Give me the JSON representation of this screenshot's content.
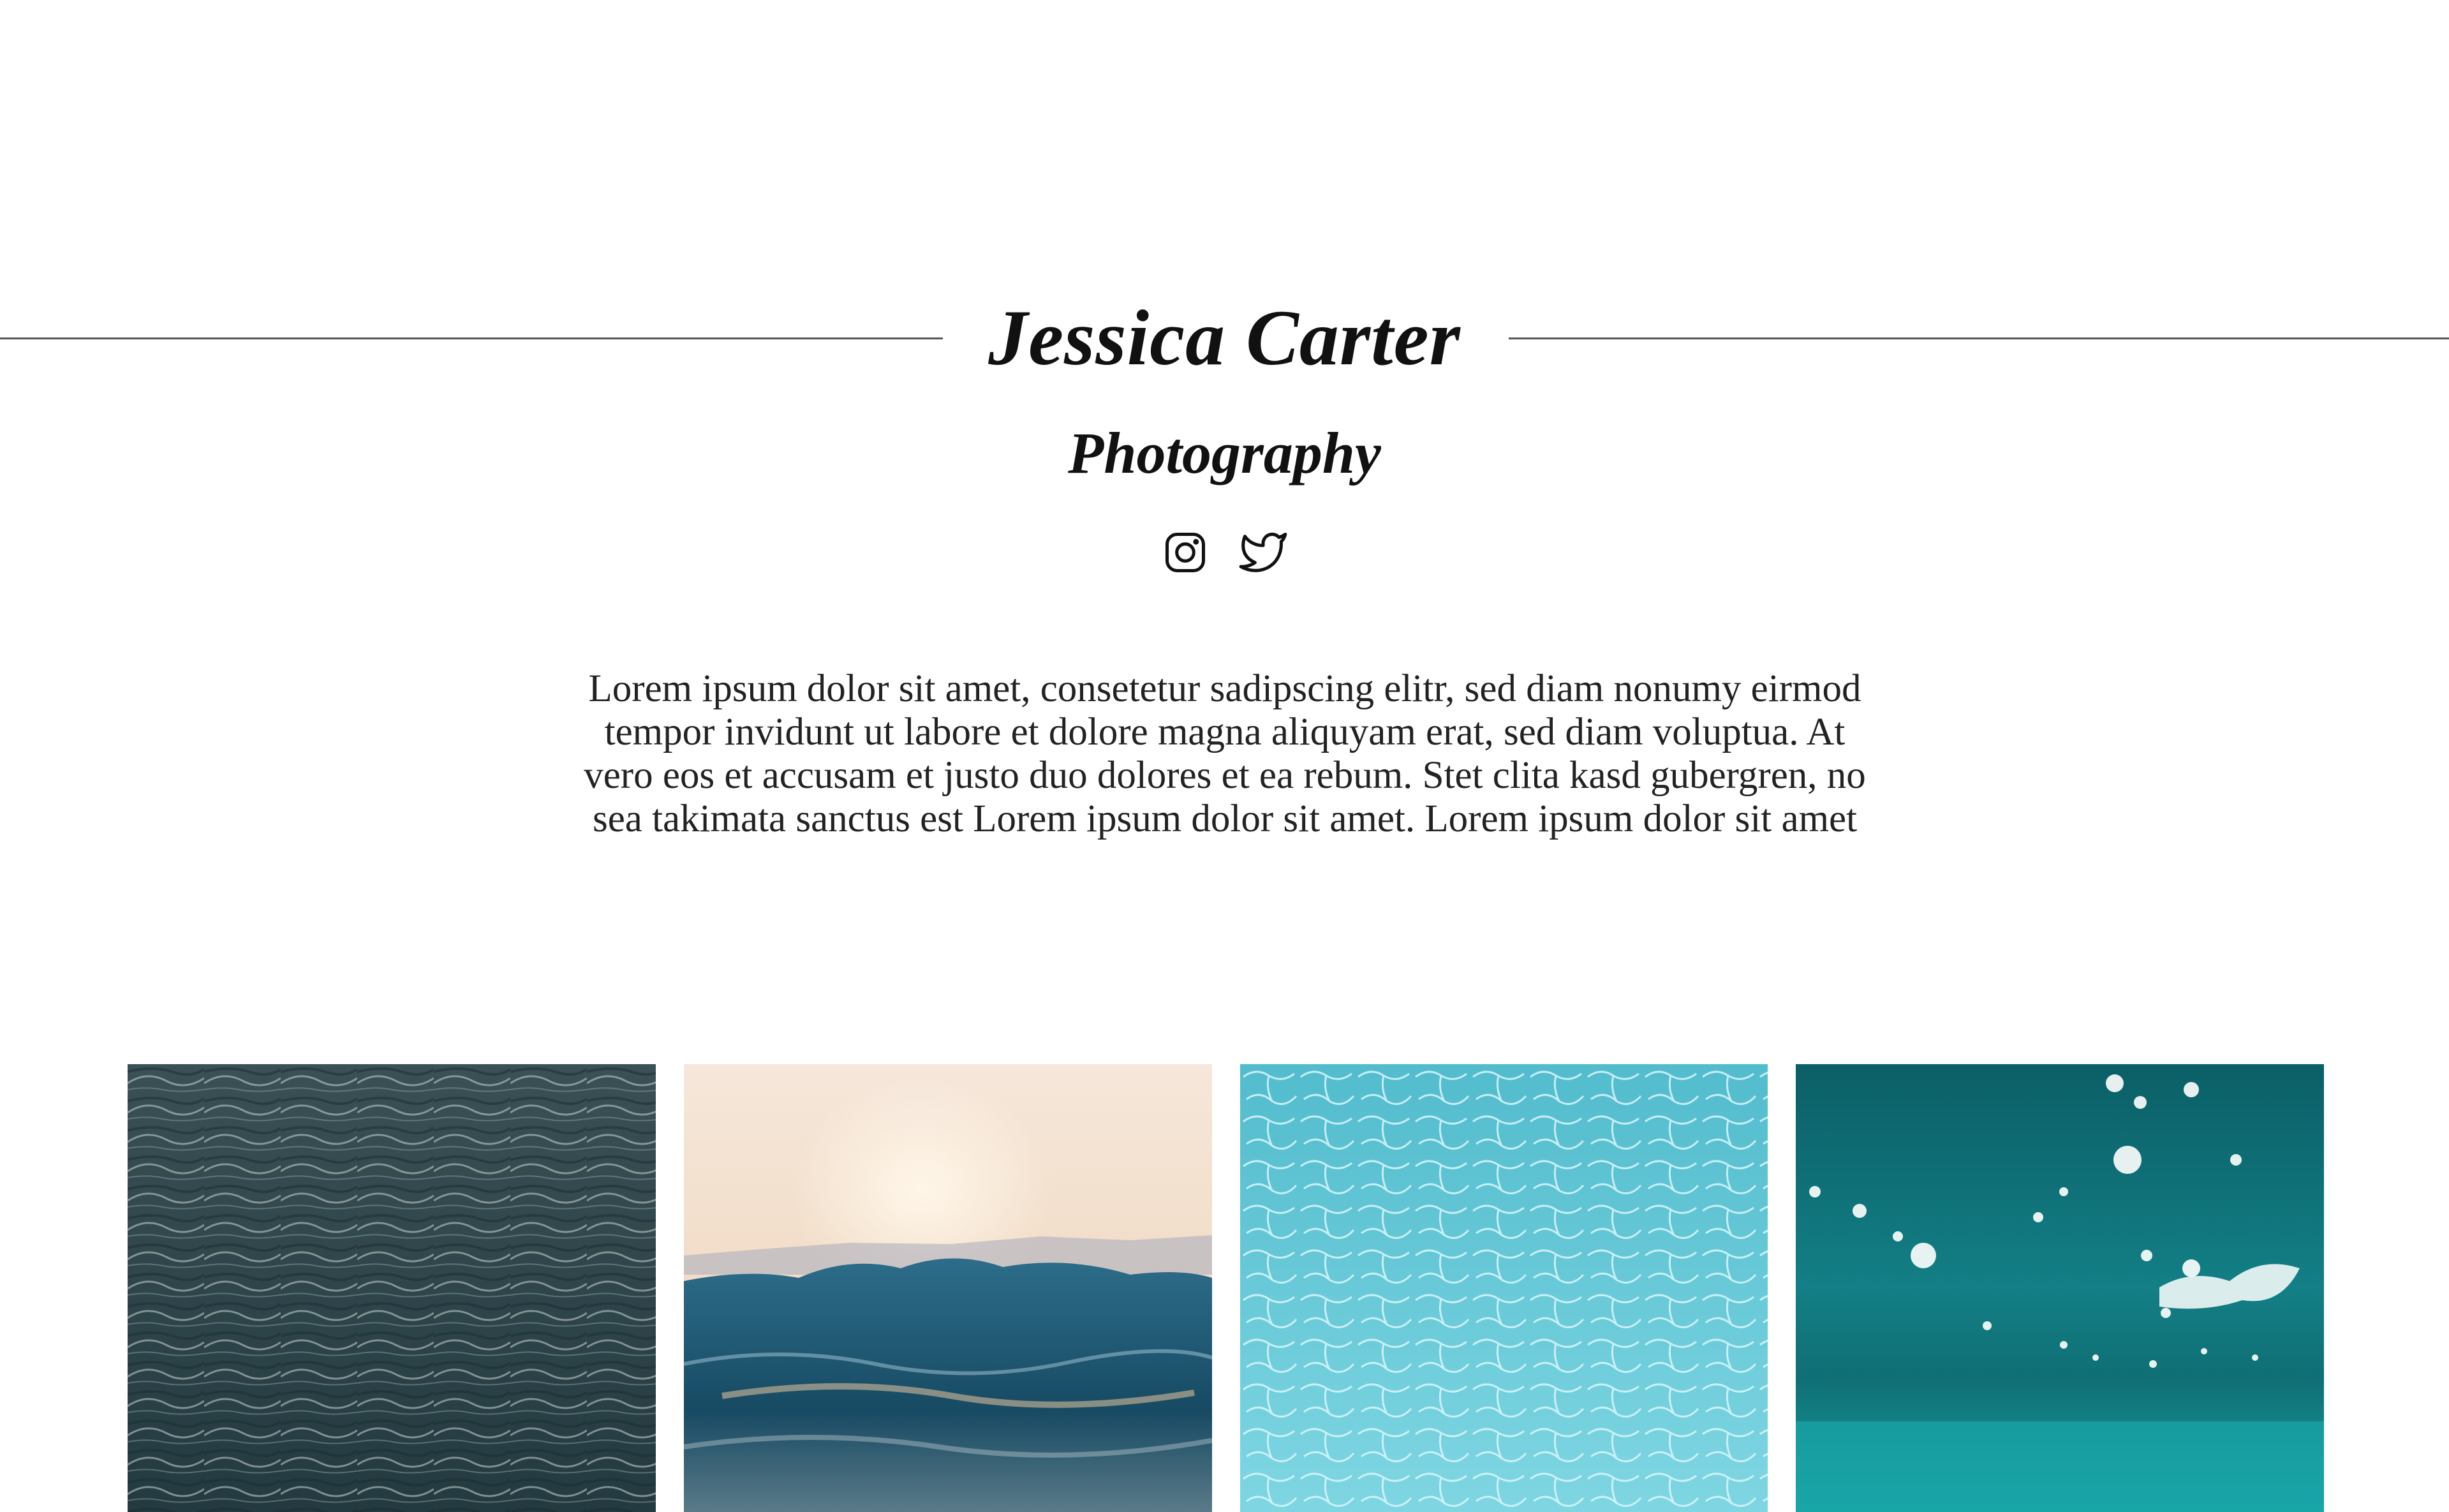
{
  "header": {
    "title": "Jessica Carter",
    "subtitle": "Photography"
  },
  "social": [
    {
      "name": "Instagram",
      "icon": "instagram-icon"
    },
    {
      "name": "Twitter",
      "icon": "twitter-icon"
    }
  ],
  "intro": {
    "text": "Lorem ipsum dolor sit amet, consetetur sadipscing elitr, sed diam nonumy eirmod tempor invidunt ut labore et dolore magna aliquyam erat, sed diam voluptua. At vero eos et accusam et justo duo dolores et ea rebum. Stet clita kasd gubergren, no sea takimata sanctus est Lorem ipsum dolor sit amet. Lorem ipsum dolor sit amet"
  },
  "gallery": [
    {
      "subject": "dark rippled water",
      "colors": [
        "#2b4248",
        "#4a6469",
        "#c9d3d2"
      ]
    },
    {
      "subject": "ocean wave at sunset",
      "colors": [
        "#f3e2d4",
        "#1f5670",
        "#e6b98a"
      ]
    },
    {
      "subject": "turquoise pool water",
      "colors": [
        "#6fc9d8",
        "#b8ecf2",
        "#3aa6bd"
      ]
    },
    {
      "subject": "underwater teal bubbles",
      "colors": [
        "#0d7178",
        "#17a0a4",
        "#ffffff"
      ]
    }
  ]
}
